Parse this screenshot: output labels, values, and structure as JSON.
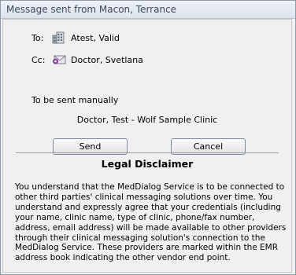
{
  "window": {
    "title": "Message sent from Macon, Terrance"
  },
  "recipients": {
    "to": {
      "label": "To:",
      "icon": "building-icon",
      "value": "Atest, Valid"
    },
    "cc": {
      "label": "Cc:",
      "icon": "envelope-icon",
      "value": "Doctor, Svetlana"
    }
  },
  "delivery": {
    "status": "To be sent manually",
    "provider": "Doctor, Test - Wolf Sample Clinic"
  },
  "buttons": {
    "send": "Send",
    "cancel": "Cancel"
  },
  "legal": {
    "title": "Legal Disclaimer",
    "text": "You understand that the MedDialog Service is to be connected to other third parties' clinical messaging solutions over time. You understand and expressly agree that your credentials (including your name, clinic name, type of clinic, phone/fax number, address, email address) will be made available to other providers through their clinical messaging solution's connection to the MedDialog Service. These providers are marked within the EMR address book indicating the other vendor end point."
  },
  "colors": {
    "title_text": "#3a4a5c",
    "window_border": "#8e9bab",
    "envelope_badge": "#8a3aa0"
  }
}
